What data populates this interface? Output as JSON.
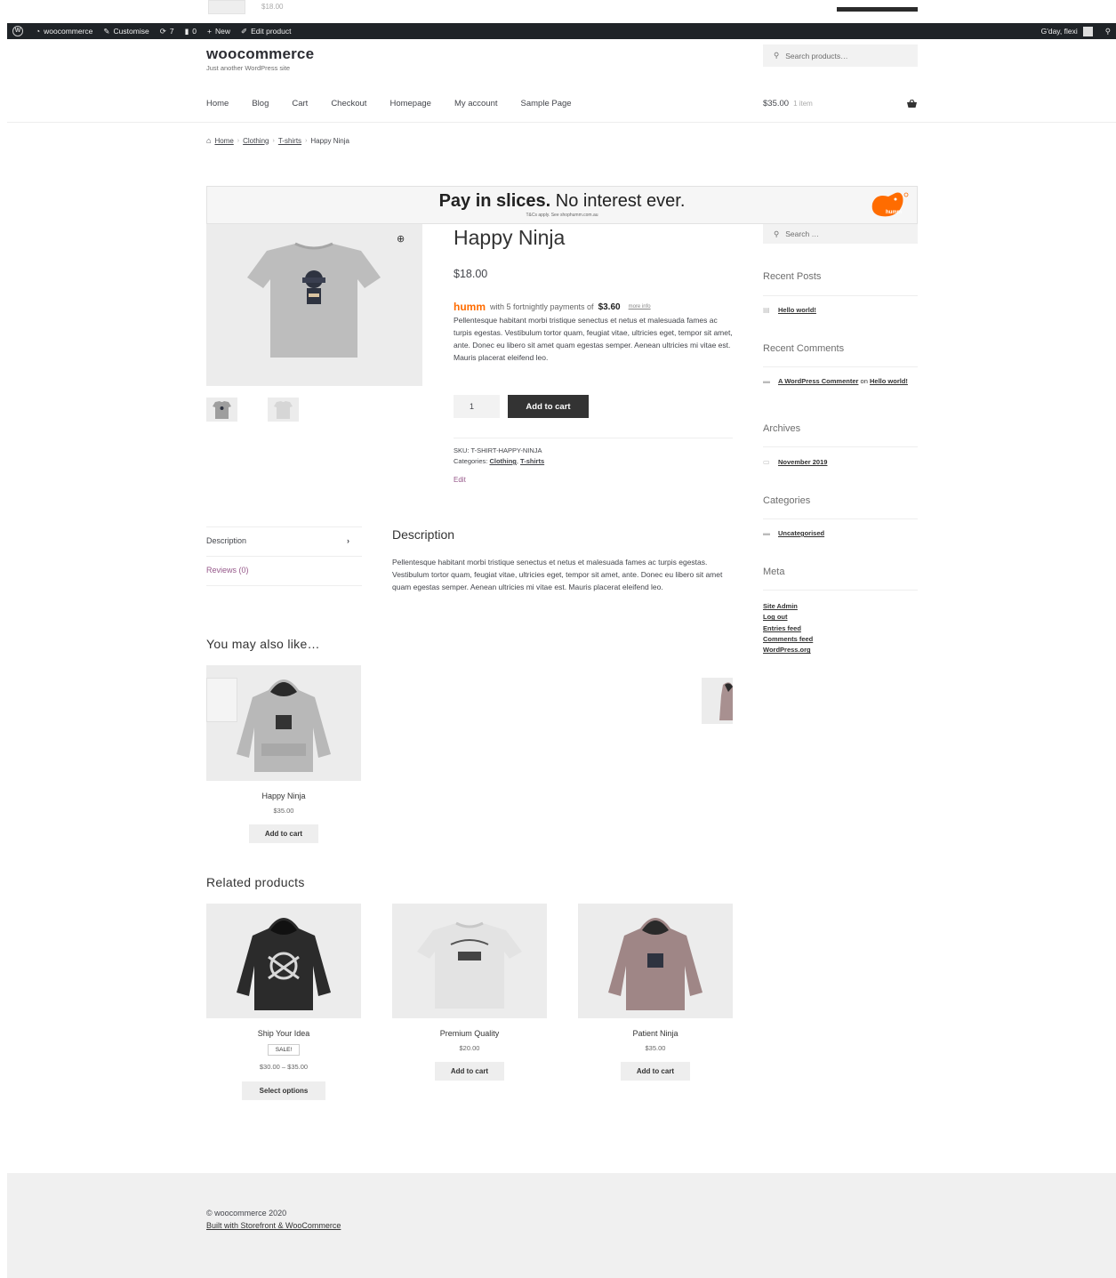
{
  "ghost": {
    "price": "$18.00"
  },
  "admin_bar": {
    "site": "woocommerce",
    "customise": "Customise",
    "updates": "7",
    "comments": "0",
    "new": "New",
    "edit_product": "Edit product",
    "greeting": "G'day, flexi"
  },
  "header": {
    "site_title": "woocommerce",
    "site_description": "Just another WordPress site",
    "search_placeholder": "Search products…",
    "nav": [
      "Home",
      "Blog",
      "Cart",
      "Checkout",
      "Homepage",
      "My account",
      "Sample Page"
    ],
    "cart_total": "$35.00",
    "cart_count": "1 item"
  },
  "breadcrumb": [
    "Home",
    "Clothing",
    "T-shirts",
    "Happy Ninja"
  ],
  "banner": {
    "headline_bold": "Pay in slices.",
    "headline_rest": " No interest ever.",
    "terms": "T&Cs apply. See shophumm.com.au",
    "brand": "humm"
  },
  "product": {
    "title": "Happy Ninja",
    "price": "$18.00",
    "humm_logo": "humm",
    "humm_text": "with 5 fortnightly payments of",
    "humm_amount": "$3.60",
    "humm_more": "more info",
    "short_description": "Pellentesque habitant morbi tristique senectus et netus et malesuada fames ac turpis egestas. Vestibulum tortor quam, feugiat vitae, ultricies eget, tempor sit amet, ante. Donec eu libero sit amet quam egestas semper. Aenean ultricies mi vitae est. Mauris placerat eleifend leo.",
    "quantity": "1",
    "add_to_cart": "Add to cart",
    "sku_label": "SKU:",
    "sku": "T-SHIRT-HAPPY-NINJA",
    "categories_label": "Categories:",
    "category_1": "Clothing",
    "category_2": "T-shirts",
    "edit": "Edit"
  },
  "tabs": {
    "description_tab": "Description",
    "reviews_tab": "Reviews (0)",
    "description_heading": "Description",
    "description_body": "Pellentesque habitant morbi tristique senectus et netus et malesuada fames ac turpis egestas. Vestibulum tortor quam, feugiat vitae, ultricies eget, tempor sit amet, ante. Donec eu libero sit amet quam egestas semper. Aenean ultricies mi vitae est. Mauris placerat eleifend leo."
  },
  "upsells": {
    "heading": "You may also like…",
    "items": [
      {
        "name": "Happy Ninja",
        "price": "$35.00",
        "button": "Add to cart"
      }
    ]
  },
  "related": {
    "heading": "Related products",
    "items": [
      {
        "name": "Ship Your Idea",
        "badge": "SALE!",
        "price": "$30.00 – $35.00",
        "button": "Select options"
      },
      {
        "name": "Premium Quality",
        "price": "$20.00",
        "button": "Add to cart"
      },
      {
        "name": "Patient Ninja",
        "price": "$35.00",
        "button": "Add to cart"
      }
    ]
  },
  "sidebar": {
    "search_placeholder": "Search …",
    "recent_posts_title": "Recent Posts",
    "recent_post": "Hello world!",
    "recent_comments_title": "Recent Comments",
    "comment_author": "A WordPress Commenter",
    "comment_on": "on",
    "comment_post": "Hello world!",
    "archives_title": "Archives",
    "archive": "November 2019",
    "categories_title": "Categories",
    "category": "Uncategorised",
    "meta_title": "Meta",
    "meta_links": [
      "Site Admin",
      "Log out",
      "Entries feed",
      "Comments feed",
      "WordPress.org"
    ]
  },
  "footer": {
    "copyright": "© woocommerce 2020",
    "built_with": "Built with Storefront & WooCommerce"
  },
  "colors": {
    "admin_bar": "#1f2327",
    "button_dark": "#333333",
    "link_purple": "#96588a",
    "humm_orange": "#ff6c00",
    "footer_bg": "#f0f0f0"
  }
}
